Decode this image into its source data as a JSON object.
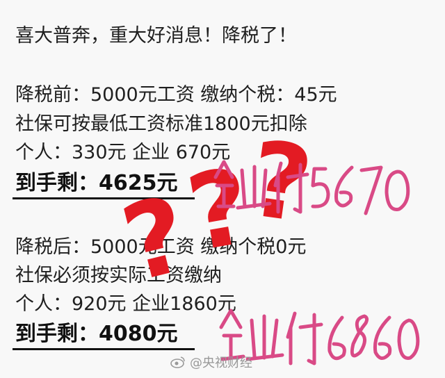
{
  "headline": "喜大普奔，重大好消息！降税了！",
  "before": {
    "line1": "降税前：5000元工资 缴纳个税：45元",
    "line2": "社保可按最低工资标准1800元扣除",
    "line3": "个人：330元  企业 670元",
    "net": "到手剩：4625元"
  },
  "after": {
    "line1": "降税后：5000元工资 缴纳个税0元",
    "line2": "社保必须按实际工资缴纳",
    "line3": "个人：920元  企业1860元",
    "net": "到手剩：4080元"
  },
  "overlay": {
    "question_mark": "?",
    "handwriting_top": "企业付5670",
    "handwriting_bottom": "企业付6860",
    "mark_color": "#e31b23"
  },
  "watermark": {
    "icon": "weibo-icon",
    "text": "@央视财经"
  }
}
